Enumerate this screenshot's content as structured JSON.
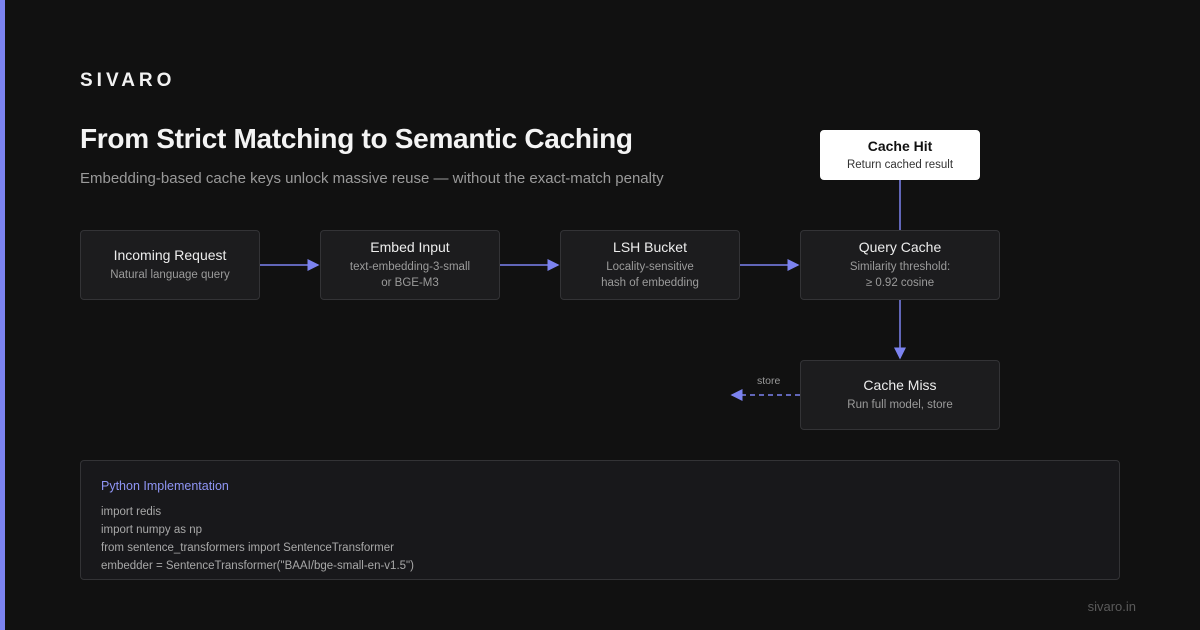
{
  "brand": "SIVARO",
  "title": "From Strict Matching to Semantic Caching",
  "subtitle": "Embedding-based cache keys unlock massive reuse — without the exact-match penalty",
  "accent_color": "#7c83f0",
  "nodes": {
    "incoming": {
      "title": "Incoming Request",
      "desc": "Natural language query"
    },
    "embed": {
      "title": "Embed Input",
      "desc": "text-embedding-3-small\nor BGE-M3"
    },
    "lsh": {
      "title": "LSH Bucket",
      "desc": "Locality-sensitive\nhash of embedding"
    },
    "query": {
      "title": "Query Cache",
      "desc": "Similarity threshold:\n≥ 0.92 cosine"
    },
    "hit": {
      "title": "Cache Hit",
      "desc": "Return cached result"
    },
    "miss": {
      "title": "Cache Miss",
      "desc": "Run full model, store"
    }
  },
  "edges": [
    {
      "from": "Incoming Request",
      "to": "Embed Input"
    },
    {
      "from": "Embed Input",
      "to": "LSH Bucket"
    },
    {
      "from": "LSH Bucket",
      "to": "Query Cache"
    },
    {
      "from": "Query Cache",
      "to": "Cache Hit",
      "style": "solid"
    },
    {
      "from": "Query Cache",
      "to": "Cache Miss",
      "style": "solid"
    },
    {
      "from": "Cache Miss",
      "to": "",
      "style": "dashed",
      "label": "store"
    }
  ],
  "code": {
    "heading": "Python Implementation",
    "lines": [
      "import redis",
      "import numpy as np",
      "from sentence_transformers import SentenceTransformer",
      "embedder = SentenceTransformer(\"BAAI/bge-small-en-v1.5\")"
    ]
  },
  "footer": {
    "url": "sivaro.in"
  }
}
